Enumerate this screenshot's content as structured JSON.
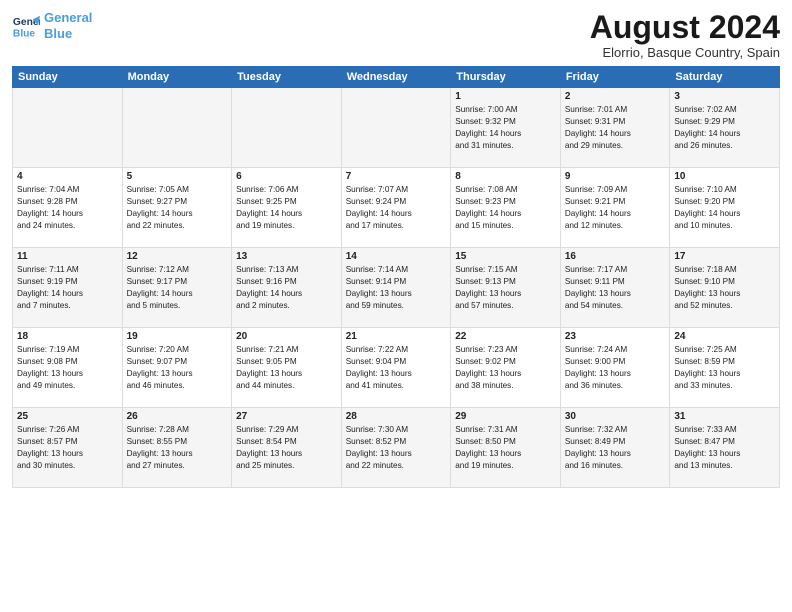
{
  "logo": {
    "line1": "General",
    "line2": "Blue"
  },
  "title": "August 2024",
  "subtitle": "Elorrio, Basque Country, Spain",
  "weekdays": [
    "Sunday",
    "Monday",
    "Tuesday",
    "Wednesday",
    "Thursday",
    "Friday",
    "Saturday"
  ],
  "weeks": [
    [
      {
        "day": "",
        "info": ""
      },
      {
        "day": "",
        "info": ""
      },
      {
        "day": "",
        "info": ""
      },
      {
        "day": "",
        "info": ""
      },
      {
        "day": "1",
        "info": "Sunrise: 7:00 AM\nSunset: 9:32 PM\nDaylight: 14 hours\nand 31 minutes."
      },
      {
        "day": "2",
        "info": "Sunrise: 7:01 AM\nSunset: 9:31 PM\nDaylight: 14 hours\nand 29 minutes."
      },
      {
        "day": "3",
        "info": "Sunrise: 7:02 AM\nSunset: 9:29 PM\nDaylight: 14 hours\nand 26 minutes."
      }
    ],
    [
      {
        "day": "4",
        "info": "Sunrise: 7:04 AM\nSunset: 9:28 PM\nDaylight: 14 hours\nand 24 minutes."
      },
      {
        "day": "5",
        "info": "Sunrise: 7:05 AM\nSunset: 9:27 PM\nDaylight: 14 hours\nand 22 minutes."
      },
      {
        "day": "6",
        "info": "Sunrise: 7:06 AM\nSunset: 9:25 PM\nDaylight: 14 hours\nand 19 minutes."
      },
      {
        "day": "7",
        "info": "Sunrise: 7:07 AM\nSunset: 9:24 PM\nDaylight: 14 hours\nand 17 minutes."
      },
      {
        "day": "8",
        "info": "Sunrise: 7:08 AM\nSunset: 9:23 PM\nDaylight: 14 hours\nand 15 minutes."
      },
      {
        "day": "9",
        "info": "Sunrise: 7:09 AM\nSunset: 9:21 PM\nDaylight: 14 hours\nand 12 minutes."
      },
      {
        "day": "10",
        "info": "Sunrise: 7:10 AM\nSunset: 9:20 PM\nDaylight: 14 hours\nand 10 minutes."
      }
    ],
    [
      {
        "day": "11",
        "info": "Sunrise: 7:11 AM\nSunset: 9:19 PM\nDaylight: 14 hours\nand 7 minutes."
      },
      {
        "day": "12",
        "info": "Sunrise: 7:12 AM\nSunset: 9:17 PM\nDaylight: 14 hours\nand 5 minutes."
      },
      {
        "day": "13",
        "info": "Sunrise: 7:13 AM\nSunset: 9:16 PM\nDaylight: 14 hours\nand 2 minutes."
      },
      {
        "day": "14",
        "info": "Sunrise: 7:14 AM\nSunset: 9:14 PM\nDaylight: 13 hours\nand 59 minutes."
      },
      {
        "day": "15",
        "info": "Sunrise: 7:15 AM\nSunset: 9:13 PM\nDaylight: 13 hours\nand 57 minutes."
      },
      {
        "day": "16",
        "info": "Sunrise: 7:17 AM\nSunset: 9:11 PM\nDaylight: 13 hours\nand 54 minutes."
      },
      {
        "day": "17",
        "info": "Sunrise: 7:18 AM\nSunset: 9:10 PM\nDaylight: 13 hours\nand 52 minutes."
      }
    ],
    [
      {
        "day": "18",
        "info": "Sunrise: 7:19 AM\nSunset: 9:08 PM\nDaylight: 13 hours\nand 49 minutes."
      },
      {
        "day": "19",
        "info": "Sunrise: 7:20 AM\nSunset: 9:07 PM\nDaylight: 13 hours\nand 46 minutes."
      },
      {
        "day": "20",
        "info": "Sunrise: 7:21 AM\nSunset: 9:05 PM\nDaylight: 13 hours\nand 44 minutes."
      },
      {
        "day": "21",
        "info": "Sunrise: 7:22 AM\nSunset: 9:04 PM\nDaylight: 13 hours\nand 41 minutes."
      },
      {
        "day": "22",
        "info": "Sunrise: 7:23 AM\nSunset: 9:02 PM\nDaylight: 13 hours\nand 38 minutes."
      },
      {
        "day": "23",
        "info": "Sunrise: 7:24 AM\nSunset: 9:00 PM\nDaylight: 13 hours\nand 36 minutes."
      },
      {
        "day": "24",
        "info": "Sunrise: 7:25 AM\nSunset: 8:59 PM\nDaylight: 13 hours\nand 33 minutes."
      }
    ],
    [
      {
        "day": "25",
        "info": "Sunrise: 7:26 AM\nSunset: 8:57 PM\nDaylight: 13 hours\nand 30 minutes."
      },
      {
        "day": "26",
        "info": "Sunrise: 7:28 AM\nSunset: 8:55 PM\nDaylight: 13 hours\nand 27 minutes."
      },
      {
        "day": "27",
        "info": "Sunrise: 7:29 AM\nSunset: 8:54 PM\nDaylight: 13 hours\nand 25 minutes."
      },
      {
        "day": "28",
        "info": "Sunrise: 7:30 AM\nSunset: 8:52 PM\nDaylight: 13 hours\nand 22 minutes."
      },
      {
        "day": "29",
        "info": "Sunrise: 7:31 AM\nSunset: 8:50 PM\nDaylight: 13 hours\nand 19 minutes."
      },
      {
        "day": "30",
        "info": "Sunrise: 7:32 AM\nSunset: 8:49 PM\nDaylight: 13 hours\nand 16 minutes."
      },
      {
        "day": "31",
        "info": "Sunrise: 7:33 AM\nSunset: 8:47 PM\nDaylight: 13 hours\nand 13 minutes."
      }
    ]
  ]
}
